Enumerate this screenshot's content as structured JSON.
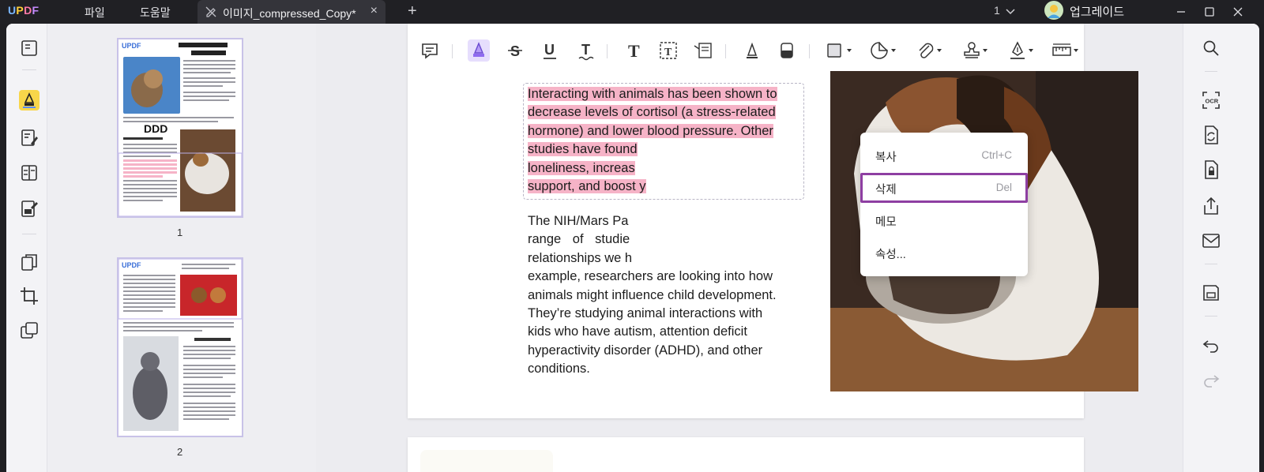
{
  "app": {
    "logo": "UPDF"
  },
  "menu": {
    "file": "파일",
    "help": "도움말"
  },
  "tab": {
    "title": "이미지_compressed_Copy*",
    "close": "×",
    "add": "+"
  },
  "page_indicator": "1",
  "upgrade_label": "업그레이드",
  "thumbnails": [
    {
      "number": "1",
      "title": "Health and Mood-Boosting Benefits of Pets",
      "overlay": "DDD",
      "heading": "Possible Health Effects"
    },
    {
      "number": "2",
      "heading": "Animals Helping People"
    }
  ],
  "document": {
    "highlighted_lines": [
      "Interacting with animals has been shown to",
      "decrease levels of cortisol (a stress-related",
      "hormone) and lower blood pressure. Other",
      "studies have found",
      "loneliness,  increas",
      "support, and boost y"
    ],
    "paragraph2_lines": [
      "The NIH/Mars Pa",
      "range   of   studie",
      "relationships  we  h",
      "example, researchers are looking into how",
      "animals might influence child development.",
      "They’re studying animal interactions with",
      "kids  who  have  autism,  attention  deficit",
      "hyperactivity  disorder  (ADHD),  and  other",
      "conditions."
    ]
  },
  "context_menu": {
    "copy": {
      "label": "복사",
      "shortcut": "Ctrl+C"
    },
    "delete": {
      "label": "삭제",
      "shortcut": "Del"
    },
    "memo": {
      "label": "메모"
    },
    "properties": {
      "label": "속성..."
    }
  },
  "colors": {
    "highlight": "#f6b3c7",
    "accent": "#8e3fa2",
    "active_tool": "#e6defd",
    "active_left": "#f8d64a"
  }
}
